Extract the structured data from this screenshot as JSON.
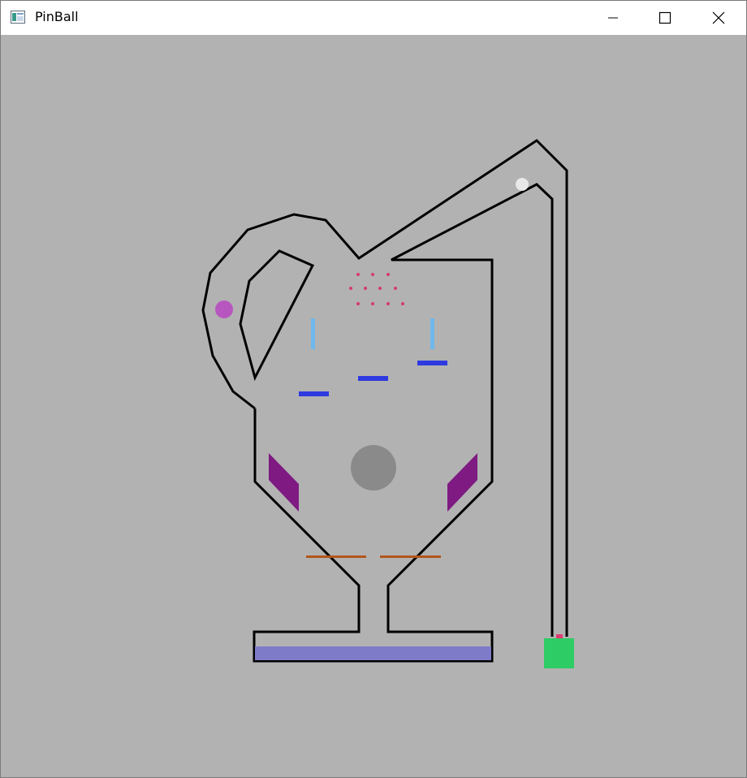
{
  "window": {
    "title": "PinBall",
    "app_icon": "window-app-icon",
    "controls": {
      "minimize_icon": "minimize-icon",
      "maximize_icon": "maximize-icon",
      "close_icon": "close-icon"
    }
  },
  "colors": {
    "titlebar_bg": "#ffffff",
    "canvas_bg": "#b2b2b2",
    "wall": "#000000",
    "ball": "#e8e8e8",
    "side_bumper": "#b856bf",
    "pins": "#d63c6a",
    "light_blue_post": "#6fb8ec",
    "blue_bar": "#2e3ae0",
    "center_bumper": "#8a8a8a",
    "slingshot": "#7e1a82",
    "flipper": "#b2561b",
    "drain": "#7e7cc8",
    "plunger": "#2ecc64",
    "plunger_tip": "#e03c70"
  }
}
